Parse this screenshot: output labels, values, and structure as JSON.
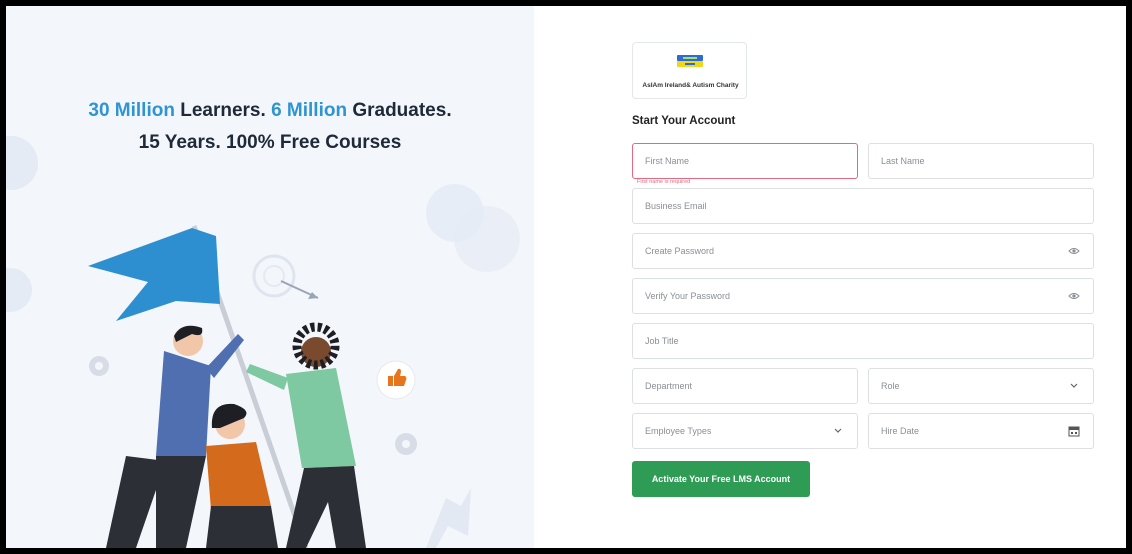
{
  "hero": {
    "line1": [
      {
        "text": "30 Million",
        "highlight": true
      },
      {
        "text": " Learners. ",
        "highlight": false
      },
      {
        "text": "6 Million",
        "highlight": true
      },
      {
        "text": " Graduates.",
        "highlight": false
      }
    ],
    "line2": "15 Years. 100% Free Courses",
    "highlight_color": "#2f95d2"
  },
  "org": {
    "name": "AsIAm Ireland& Autism Charity"
  },
  "form": {
    "title": "Start Your Account",
    "first_name": {
      "placeholder": "First Name",
      "error": "First name is required"
    },
    "last_name": {
      "placeholder": "Last Name"
    },
    "email": {
      "placeholder": "Business Email"
    },
    "password": {
      "placeholder": "Create Password",
      "icon": "eye-icon"
    },
    "verify_password": {
      "placeholder": "Verify Your Password",
      "icon": "eye-icon"
    },
    "job_title": {
      "placeholder": "Job Title"
    },
    "department": {
      "placeholder": "Department"
    },
    "role": {
      "placeholder": "Role",
      "icon": "chevron-down-icon"
    },
    "employee_types": {
      "placeholder": "Employee Types",
      "icon": "chevron-down-icon"
    },
    "hire_date": {
      "placeholder": "Hire Date",
      "icon": "calendar-icon"
    },
    "submit_label": "Activate Your Free LMS Account",
    "submit_color": "#2e9c55"
  }
}
